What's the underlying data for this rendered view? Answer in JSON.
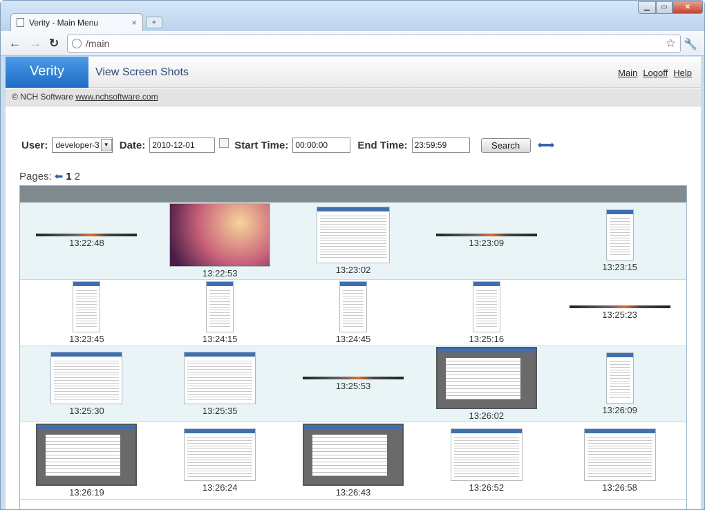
{
  "browser": {
    "tab_title": "Verity - Main Menu",
    "tab_close": "×",
    "new_tab": "+",
    "url": "/main"
  },
  "app": {
    "brand": "Verity",
    "section": "View Screen Shots",
    "links": [
      "Main",
      "Logoff",
      "Help"
    ],
    "copyright_prefix": "© NCH Software",
    "copyright_link": "www.nchsoftware.com"
  },
  "search": {
    "user_label": "User:",
    "user_value": "developer-3",
    "date_label": "Date:",
    "date_value": "2010-12-01",
    "start_label": "Start Time:",
    "start_value": "00:00:00",
    "end_label": "End Time:",
    "end_value": "23:59:59",
    "button": "Search"
  },
  "pagination": {
    "label": "Pages:",
    "current": "1",
    "other": "2"
  },
  "screenshots": [
    [
      {
        "time": "13:22:48",
        "kind": "strip"
      },
      {
        "time": "13:22:53",
        "kind": "desktop"
      },
      {
        "time": "13:23:02",
        "kind": "doc"
      },
      {
        "time": "13:23:09",
        "kind": "strip"
      },
      {
        "time": "13:23:15",
        "kind": "tall"
      }
    ],
    [
      {
        "time": "13:23:45",
        "kind": "tall"
      },
      {
        "time": "13:24:15",
        "kind": "tall"
      },
      {
        "time": "13:24:45",
        "kind": "tall"
      },
      {
        "time": "13:25:16",
        "kind": "tall"
      },
      {
        "time": "13:25:23",
        "kind": "strip"
      }
    ],
    [
      {
        "time": "13:25:30",
        "kind": "wide"
      },
      {
        "time": "13:25:35",
        "kind": "wide"
      },
      {
        "time": "13:25:53",
        "kind": "strip"
      },
      {
        "time": "13:26:02",
        "kind": "dark"
      },
      {
        "time": "13:26:09",
        "kind": "tall"
      }
    ],
    [
      {
        "time": "13:26:19",
        "kind": "dark"
      },
      {
        "time": "13:26:24",
        "kind": "wide"
      },
      {
        "time": "13:26:43",
        "kind": "dark"
      },
      {
        "time": "13:26:52",
        "kind": "wide"
      },
      {
        "time": "13:26:58",
        "kind": "wide"
      }
    ]
  ]
}
